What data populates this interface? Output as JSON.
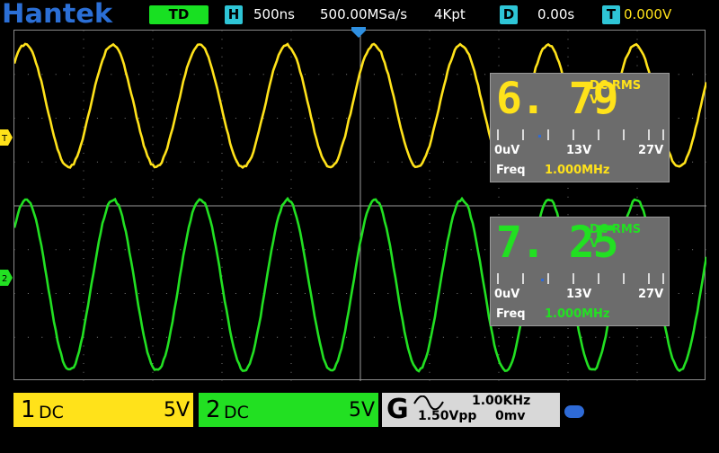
{
  "brand": "Hantek",
  "top": {
    "mode": "TD",
    "h_label": "H",
    "timebase": "500ns",
    "sample_rate": "500.00MSa/s",
    "memory": "4Kpt",
    "d_label": "D",
    "delay": "0.00s",
    "t_label": "T",
    "trigger_level": "0.000V"
  },
  "markers": {
    "trigger": "T",
    "ch1": "1",
    "ch2": "2"
  },
  "meas1": {
    "value": "6. 79",
    "unit_line1": "DC RMS",
    "unit_line2": "V",
    "scale_min": "0uV",
    "scale_mid": "13V",
    "scale_max": "27V",
    "freq_label": "Freq",
    "freq_value": "1.000MHz",
    "color": "#ffe21a"
  },
  "meas2": {
    "value": "7. 25",
    "unit_line1": "DC RMS",
    "unit_line2": "V",
    "scale_min": "0uV",
    "scale_mid": "13V",
    "scale_max": "27V",
    "freq_label": "Freq",
    "freq_value": "1.000MHz",
    "color": "#22e022"
  },
  "ch1": {
    "number": "1",
    "coupling": "DC",
    "volts_div": "5V",
    "color": "#ffe21a"
  },
  "ch2": {
    "number": "2",
    "coupling": "DC",
    "volts_div": "5V",
    "color": "#22e022"
  },
  "generator": {
    "label": "G",
    "waveform": "sine-wave-icon",
    "frequency": "1.00KHz",
    "amplitude": "1.50Vpp",
    "offset": "0mv"
  },
  "icons": {
    "usb": "usb-icon"
  },
  "colors": {
    "grid": "#7a7a7a",
    "logo": "#2b6fd6",
    "accent_cyan": "#2ec5d6"
  }
}
